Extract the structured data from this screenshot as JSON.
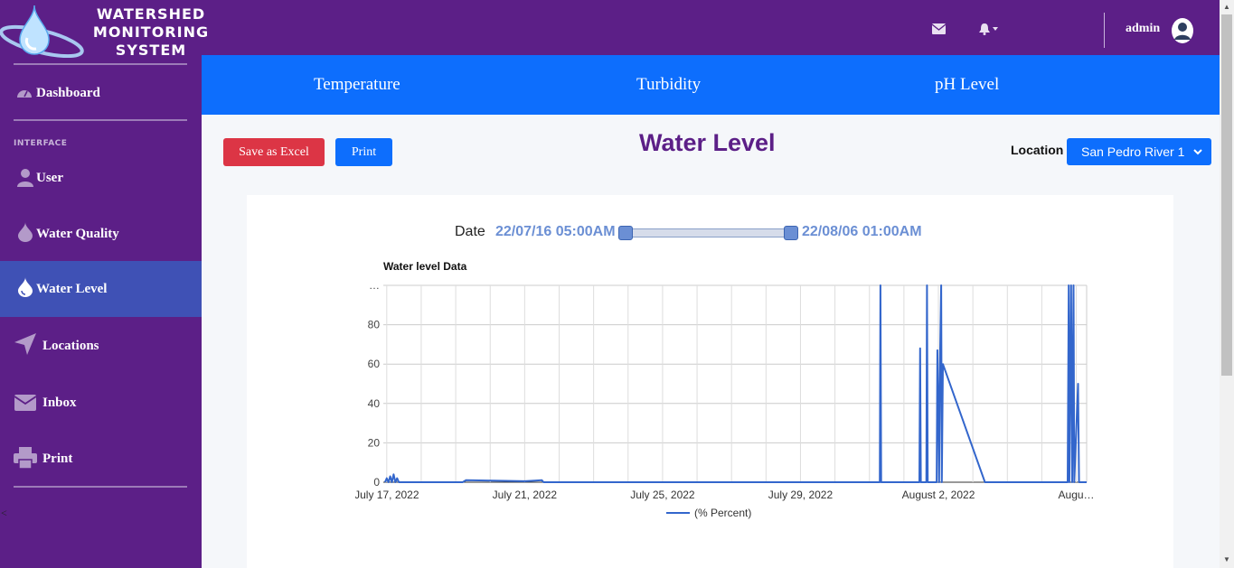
{
  "brand": {
    "lines": [
      "WATERSHED",
      "MONITORING",
      "SYSTEM"
    ]
  },
  "topbar": {
    "admin_label": "admin",
    "mail_icon": "envelope-icon",
    "bell_icon": "bell-icon"
  },
  "sidebar": {
    "heading": "INTERFACE",
    "collapse": "<",
    "items": [
      {
        "label": "Dashboard",
        "icon": "gauge-icon"
      },
      {
        "label": "User",
        "icon": "user-icon"
      },
      {
        "label": "Water Quality",
        "icon": "droplet-icon"
      },
      {
        "label": "Water Level",
        "icon": "droplet-icon",
        "active": true
      },
      {
        "label": "Locations",
        "icon": "location-arrow-icon"
      },
      {
        "label": "Inbox",
        "icon": "envelope-icon"
      },
      {
        "label": "Print",
        "icon": "printer-icon"
      }
    ]
  },
  "tabs": [
    "Temperature",
    "Turbidity",
    "pH Level"
  ],
  "toolbar": {
    "excel_label": "Save as Excel",
    "print_label": "Print"
  },
  "page_title": "Water Level",
  "location": {
    "label": "Location",
    "selected": "San Pedro River 1"
  },
  "date_range": {
    "label": "Date",
    "start": "22/07/16 05:00AM",
    "end": "22/08/06 01:00AM"
  },
  "colors": {
    "purple": "#5c1f87",
    "blue": "#0d6efd",
    "active": "#3f51b5",
    "red": "#dc3545",
    "line": "#3366cc"
  },
  "chart_data": {
    "type": "line",
    "title": "Water level Data",
    "xlabel": "",
    "ylabel": "",
    "ylim": [
      0,
      100
    ],
    "y_ticks": [
      "0",
      "20",
      "40",
      "60",
      "80",
      "…"
    ],
    "x_ticks": [
      "July 17, 2022",
      "July 21, 2022",
      "July 25, 2022",
      "July 29, 2022",
      "August 2, 2022",
      "Augu…"
    ],
    "x_tick_days": [
      17,
      21,
      25,
      29,
      33,
      37
    ],
    "xlim_days": [
      16.9,
      37.3
    ],
    "legend_position": "bottom",
    "grid": true,
    "series": [
      {
        "name": "(% Percent)",
        "points": [
          [
            16.95,
            0
          ],
          [
            17.0,
            2
          ],
          [
            17.05,
            0
          ],
          [
            17.1,
            3
          ],
          [
            17.15,
            0
          ],
          [
            17.2,
            4
          ],
          [
            17.25,
            0
          ],
          [
            17.3,
            2
          ],
          [
            17.35,
            0
          ],
          [
            19.2,
            0
          ],
          [
            19.3,
            1
          ],
          [
            21.0,
            0.5
          ],
          [
            21.3,
            0.8
          ],
          [
            21.5,
            1
          ],
          [
            21.55,
            0
          ],
          [
            31.3,
            0
          ],
          [
            31.32,
            100
          ],
          [
            31.34,
            0
          ],
          [
            32.45,
            0
          ],
          [
            32.47,
            68
          ],
          [
            32.49,
            0
          ],
          [
            32.65,
            0
          ],
          [
            32.67,
            100
          ],
          [
            32.69,
            0
          ],
          [
            32.95,
            0
          ],
          [
            32.97,
            67
          ],
          [
            33.0,
            40
          ],
          [
            33.02,
            0
          ],
          [
            33.05,
            65
          ],
          [
            33.08,
            100
          ],
          [
            33.1,
            0
          ],
          [
            33.13,
            60
          ],
          [
            34.35,
            0
          ],
          [
            36.75,
            0
          ],
          [
            36.78,
            100
          ],
          [
            36.8,
            0
          ],
          [
            36.85,
            100
          ],
          [
            36.88,
            0
          ],
          [
            36.92,
            100
          ],
          [
            36.94,
            0
          ],
          [
            37.05,
            50
          ],
          [
            37.08,
            0
          ],
          [
            37.3,
            0
          ]
        ]
      }
    ]
  }
}
